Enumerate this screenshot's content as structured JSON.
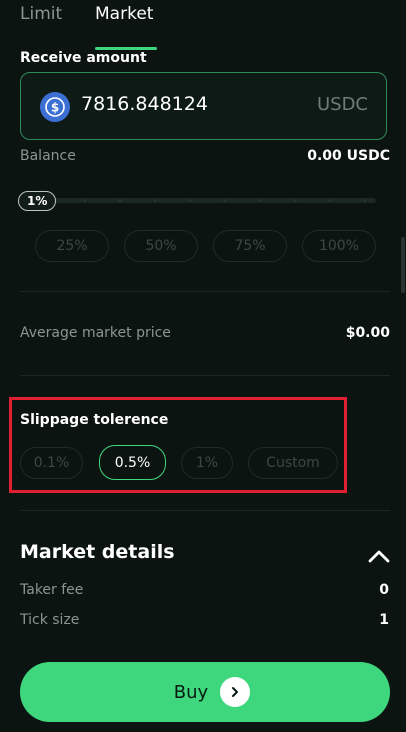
{
  "tabs": [
    {
      "label": "Limit",
      "active": false
    },
    {
      "label": "Market",
      "active": true
    }
  ],
  "receive": {
    "label": "Receive amount",
    "amount": "7816.848124",
    "unit": "USDC",
    "coin_icon": "usdc-coin-icon"
  },
  "balance": {
    "label": "Balance",
    "value": "0.00 USDC"
  },
  "slider": {
    "value_label": "1%",
    "value": 1
  },
  "presets": [
    "25%",
    "50%",
    "75%",
    "100%"
  ],
  "average_price": {
    "label": "Average market price",
    "value": "$0.00"
  },
  "slippage": {
    "label": "Slippage tolerence",
    "options": [
      "0.1%",
      "0.5%",
      "1%",
      "Custom"
    ],
    "selected": "0.5%"
  },
  "market_details": {
    "title": "Market details",
    "rows": [
      {
        "label": "Taker fee",
        "value": "0"
      },
      {
        "label": "Tick size",
        "value": "1"
      }
    ]
  },
  "buy_button": {
    "label": "Buy"
  },
  "colors": {
    "accent": "#3fd77d",
    "background": "#0c1412",
    "highlight": "#e02030"
  }
}
